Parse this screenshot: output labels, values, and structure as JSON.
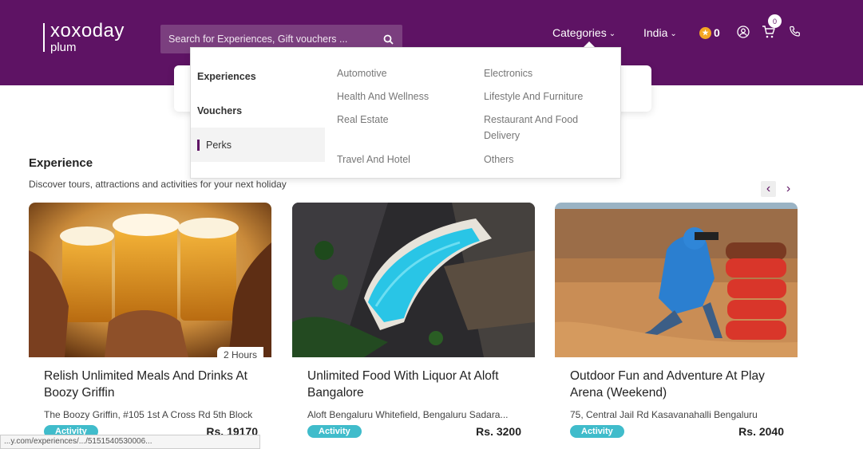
{
  "header": {
    "logo_main": "xoxoday",
    "logo_sub": "plum",
    "search_placeholder": "Search for Experiences, Gift vouchers ...",
    "categories_label": "Categories",
    "country_label": "India",
    "points": "0",
    "cart_count": "0"
  },
  "dropdown": {
    "categories": [
      "Experiences",
      "Vouchers",
      "Perks"
    ],
    "active_category": "Perks",
    "col1": [
      "Automotive",
      "Health And Wellness",
      "Real Estate",
      "Travel And Hotel"
    ],
    "col2": [
      "Electronics",
      "Lifestyle And Furniture",
      "Restaurant And Food Delivery",
      "Others"
    ]
  },
  "section": {
    "title": "Experience",
    "subtitle": "Discover tours, attractions and activities for your next holiday"
  },
  "cards": [
    {
      "title": "Relish Unlimited Meals And Drinks At Boozy Griffin",
      "address": "The Boozy Griffin, #105 1st A Cross Rd 5th Block",
      "badge": "Activity",
      "price": "Rs. 19170",
      "duration": "2 Hours"
    },
    {
      "title": "Unlimited Food With Liquor At Aloft Bangalore",
      "address": "Aloft Bengaluru Whitefield, Bengaluru Sadara...",
      "badge": "Activity",
      "price": "Rs. 3200"
    },
    {
      "title": "Outdoor Fun and Adventure At Play Arena (Weekend)",
      "address": "75, Central Jail Rd Kasavanahalli Bengaluru",
      "badge": "Activity",
      "price": "Rs. 2040"
    }
  ],
  "status_url": "...y.com/experiences/.../5151540530006..."
}
